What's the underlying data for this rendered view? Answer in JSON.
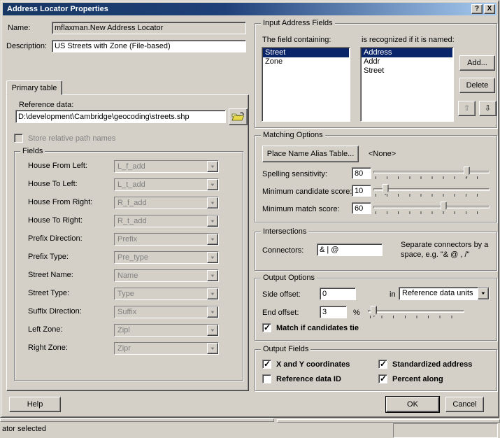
{
  "colors": {
    "dialog_bg": "#d4d0c8",
    "titlebar_left": "#173764",
    "titlebar_right": "#a6caf0",
    "selection_bg": "#0a246a",
    "selection_text": "#ffffff",
    "disabled_text": "#808080"
  },
  "icons": {
    "dropdown_arrow": "▼",
    "up_arrow": "⇧",
    "down_arrow": "⇩",
    "check": "✓",
    "help_glyph": "?",
    "close_glyph": "X"
  },
  "window": {
    "title": "Address Locator Properties"
  },
  "header": {
    "name_label": "Name:",
    "name_value": "mflaxman.New Address Locator",
    "description_label": "Description:",
    "description_value": "US Streets with Zone (File-based)"
  },
  "primary_tab": {
    "tab_label": "Primary table",
    "reference_data_label": "Reference data:",
    "reference_data_value": "D:\\development\\Cambridge\\geocoding\\streets.shp",
    "store_relative_label": "Store relative path names",
    "fields": {
      "title": "Fields",
      "rows": [
        {
          "label": "House From Left:",
          "value": "L_f_add"
        },
        {
          "label": "House To Left:",
          "value": "L_t_add"
        },
        {
          "label": "House From Right:",
          "value": "R_f_add"
        },
        {
          "label": "House To Right:",
          "value": "R_t_add"
        },
        {
          "label": "Prefix Direction:",
          "value": "Prefix"
        },
        {
          "label": "Prefix Type:",
          "value": "Pre_type"
        },
        {
          "label": "Street Name:",
          "value": "Name"
        },
        {
          "label": "Street Type:",
          "value": "Type"
        },
        {
          "label": "Suffix Direction:",
          "value": "Suffix"
        },
        {
          "label": "Left Zone:",
          "value": "Zipl"
        },
        {
          "label": "Right Zone:",
          "value": "Zipr"
        }
      ]
    },
    "help_button": "Help"
  },
  "input_address_fields": {
    "title": "Input Address Fields",
    "left_list_label": "The field containing:",
    "right_list_label": "is recognized if it is named:",
    "left_items": [
      "Street",
      "Zone"
    ],
    "left_selected": "Street",
    "right_items": [
      "Address",
      "Addr",
      "Street"
    ],
    "right_selected": "Address",
    "add_button": "Add...",
    "delete_button": "Delete"
  },
  "matching_options": {
    "title": "Matching Options",
    "alias_button": "Place Name Alias Table...",
    "alias_value": "<None>",
    "spelling": {
      "label": "Spelling sensitivity:",
      "value": 80
    },
    "candidate": {
      "label": "Minimum candidate score:",
      "value": 10
    },
    "match": {
      "label": "Minimum match score:",
      "value": 60
    }
  },
  "intersections": {
    "title": "Intersections",
    "connectors_label": "Connectors:",
    "connectors_value": "& | @",
    "note": "Separate connectors by a space, e.g. \"& @ , /\""
  },
  "output_options": {
    "title": "Output Options",
    "side_offset_label": "Side offset:",
    "side_offset_value": "0",
    "unit_conj": "in",
    "unit_value": "Reference data units",
    "end_offset_label": "End offset:",
    "end_offset_value": "3",
    "end_offset_unit": "%",
    "end_offset_percent": 6,
    "tie_checkbox_label": "Match if candidates tie",
    "tie_checked": true
  },
  "output_fields": {
    "title": "Output Fields",
    "checkboxes": [
      {
        "label": "X and Y coordinates",
        "checked": true
      },
      {
        "label": "Reference data ID",
        "checked": false
      },
      {
        "label": "Standardized address",
        "checked": true
      },
      {
        "label": "Percent along",
        "checked": true
      }
    ]
  },
  "footer": {
    "ok_button": "OK",
    "cancel_button": "Cancel"
  },
  "statusbar": {
    "text": "ator selected"
  }
}
